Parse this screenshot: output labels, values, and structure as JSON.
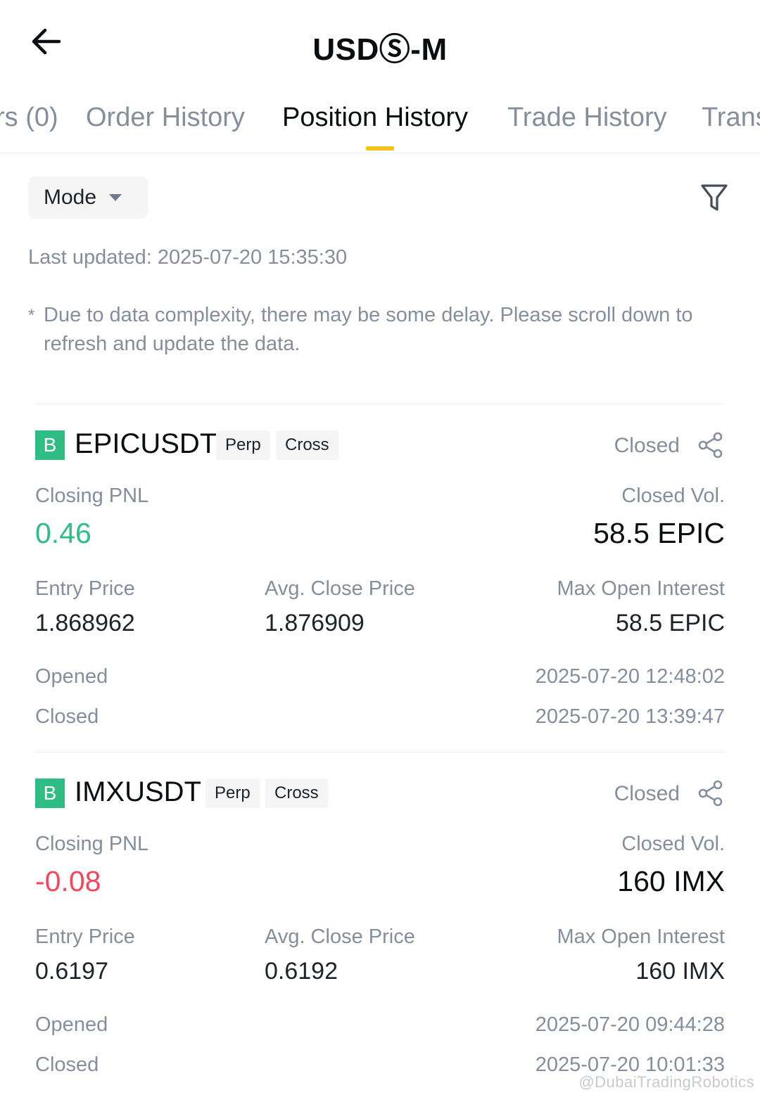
{
  "header": {
    "title": "USDⓈ-M",
    "back_icon": "arrow-left-icon"
  },
  "tabs": [
    {
      "label": "rs (0)"
    },
    {
      "label": "Order History"
    },
    {
      "label": "Position History"
    },
    {
      "label": "Trade History"
    },
    {
      "label": "Trans"
    }
  ],
  "active_tab": "Position History",
  "accent_color": "#f0c419",
  "toolbar": {
    "mode_label": "Mode",
    "filter_icon": "filter-icon"
  },
  "last_updated": "Last updated: 2025-07-20 15:35:30",
  "notice": {
    "star": "*",
    "text": "Due to data complexity, there may be some delay. Please scroll down to refresh and update the data."
  },
  "labels": {
    "closing_pnl": "Closing PNL",
    "closed_vol": "Closed Vol.",
    "entry_price": "Entry Price",
    "avg_close_price": "Avg. Close Price",
    "max_open_interest": "Max Open Interest",
    "opened": "Opened",
    "closed": "Closed"
  },
  "positions": [
    {
      "side_badge": "B",
      "symbol": "EPICUSDT",
      "chips": [
        "Perp",
        "Cross"
      ],
      "status": "Closed",
      "closing_pnl": "0.46",
      "pnl_color": "#2ebd85",
      "closed_vol": "58.5 EPIC",
      "entry_price": "1.868962",
      "avg_close_price": "1.876909",
      "max_open_interest": "58.5 EPIC",
      "opened_time": "2025-07-20 12:48:02",
      "closed_time": "2025-07-20 13:39:47"
    },
    {
      "side_badge": "B",
      "symbol": "IMXUSDT",
      "chips": [
        "Perp",
        "Cross"
      ],
      "status": "Closed",
      "closing_pnl": "-0.08",
      "pnl_color": "#f6465d",
      "closed_vol": "160 IMX",
      "entry_price": "0.6197",
      "avg_close_price": "0.6192",
      "max_open_interest": "160 IMX",
      "opened_time": "2025-07-20 09:44:28",
      "closed_time": "2025-07-20 10:01:33"
    }
  ],
  "watermark": "@DubaiTradingRobotics"
}
